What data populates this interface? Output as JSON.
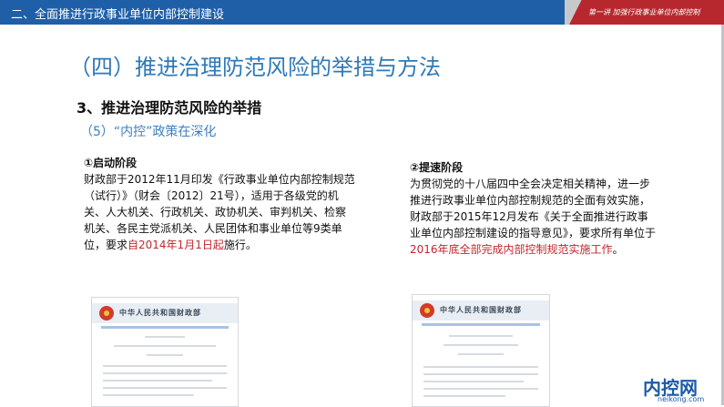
{
  "header": {
    "title": "二、全面推进行政事业单位内部控制建设",
    "subtitle": "第一讲  加强行政事业单位内部控制"
  },
  "heading": "（四）推进治理防范风险的举措与方法",
  "subheading": "3、推进治理防范风险的举措",
  "subsub": "（5）“内控”政策在深化",
  "left": {
    "title": "①启动阶段",
    "text_before": "财政部于2012年11月印发《行政事业单位内部控制规范（试行）》（财会〔2012〕21号），适用于各级党的机关、人大机关、行政机关、政协机关、审判机关、检察机关、各民主党派机关、人民团体和事业单位等9类单位，要求",
    "text_highlight": "自2014年1月1日起",
    "text_after": "施行。"
  },
  "right": {
    "title": "②提速阶段",
    "text_before": "为贯彻党的十八届四中全会决定相关精神，进一步推进行政事业单位内部控制规范的全面有效实施，财政部于2015年12月发布《关于全面推进行政事业单位内部控制建设的指导意见》，要求所有单位于",
    "text_highlight": "2016年底全部完成内部控制规范实施工作",
    "text_after": "。"
  },
  "doc_images": {
    "ministry_text": "中华人民共和国财政部"
  },
  "logo": {
    "name": "内控网",
    "url_text": "neikong.com"
  },
  "colors": {
    "header_blue": "#1f5fa8",
    "header_red": "#b7282e",
    "heading_blue": "#2e79b8",
    "highlight_red": "#c0272d"
  }
}
